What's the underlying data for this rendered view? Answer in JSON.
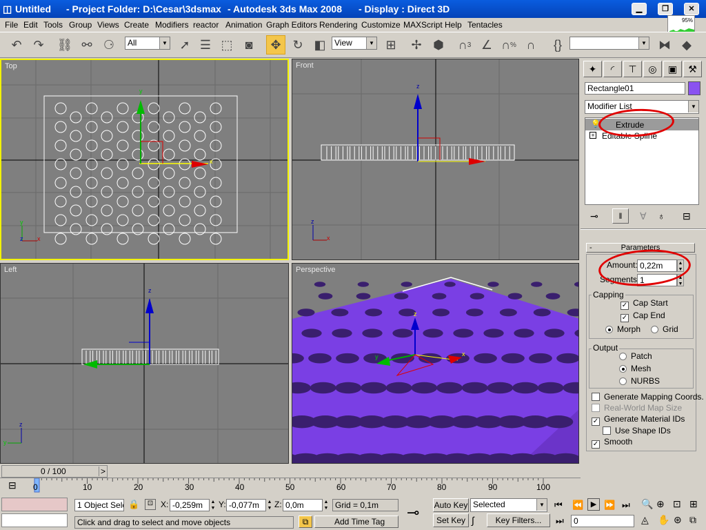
{
  "window": {
    "title": "Untitled",
    "project": "- Project Folder: D:\\Cesar\\3dsmax",
    "app": "- Autodesk 3ds Max 2008",
    "display": "- Display : Direct 3D",
    "min": "▁",
    "max": "❐",
    "close": "✕"
  },
  "menu": [
    "File",
    "Edit",
    "Tools",
    "Group",
    "Views",
    "Create",
    "Modifiers",
    "reactor",
    "Animation",
    "Graph Editors",
    "Rendering",
    "Customize",
    "MAXScript",
    "Help",
    "Tentacles"
  ],
  "toolbar": {
    "filter": "All",
    "refcoord": "View",
    "snap_label": "3",
    "percent_label": "%",
    "selection_set": "",
    "mini_graph_value": "95%"
  },
  "viewports": {
    "top": "Top",
    "front": "Front",
    "left": "Left",
    "perspective": "Perspective",
    "axis_x": "x",
    "axis_y": "y",
    "axis_z": "z"
  },
  "command_panel": {
    "object_name": "Rectangle01",
    "object_color": "#8a52f0",
    "modifier_list": "Modifier List",
    "stack": [
      "Extrude",
      "Editable Spline"
    ],
    "stack_expand": "+",
    "rollout_toggle": "-",
    "rollout_title": "Parameters",
    "amount_label": "Amount:",
    "amount_value": "0,22m",
    "segments_label": "Segments:",
    "segments_value": "1",
    "capping_label": "Capping",
    "cap_start": "Cap Start",
    "cap_end": "Cap End",
    "morph": "Morph",
    "grid": "Grid",
    "output_label": "Output",
    "patch": "Patch",
    "mesh": "Mesh",
    "nurbs": "NURBS",
    "gen_mapping": "Generate Mapping Coords.",
    "real_world": "Real-World Map Size",
    "gen_material": "Generate Material IDs",
    "use_shape": "Use Shape IDs",
    "smooth": "Smooth",
    "check": "✓"
  },
  "timeline": {
    "frame": "0 / 100",
    "ticks": [
      "0",
      "10",
      "20",
      "30",
      "40",
      "50",
      "60",
      "70",
      "80",
      "90",
      "100"
    ],
    "prev": "<",
    "next": ">"
  },
  "status": {
    "selection": "1 Object Sele",
    "x_label": "X:",
    "x_value": "-0,259m",
    "y_label": "Y:",
    "y_value": "-0,077m",
    "z_label": "Z:",
    "z_value": "0,0m",
    "grid": "Grid = 0,1m",
    "prompt": "Click and drag to select and move objects",
    "add_time_tag": "Add Time Tag",
    "auto_key": "Auto Key",
    "selected": "Selected",
    "set_key": "Set Key",
    "key_filters": "Key Filters...",
    "frame_field": "0"
  },
  "colors": {
    "accent_purple": "#7a3fe4",
    "viewport_bg": "#7f7f7f",
    "active_border": "#f2f200",
    "annotation_red": "#e00000"
  }
}
